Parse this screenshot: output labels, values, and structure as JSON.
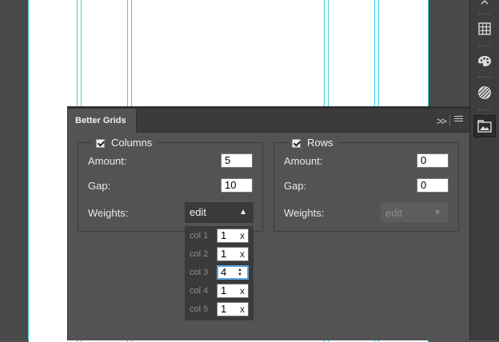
{
  "panel": {
    "tab_title": "Better Grids",
    "collapse_glyph": ">>",
    "columns": {
      "title": "Columns",
      "checked": true,
      "amount_label": "Amount:",
      "amount_value": "5",
      "gap_label": "Gap:",
      "gap_value": "10",
      "weights_label": "Weights:",
      "weights_dropdown": "edit",
      "weights_dropdown_arrow": "▲",
      "weights": [
        {
          "label": "col 1",
          "value": "1",
          "action": "x"
        },
        {
          "label": "col 2",
          "value": "1",
          "action": "x"
        },
        {
          "label": "col 3",
          "value": "4",
          "action": "spinner"
        },
        {
          "label": "col 4",
          "value": "1",
          "action": "x"
        },
        {
          "label": "col 5",
          "value": "1",
          "action": "x"
        }
      ]
    },
    "rows": {
      "title": "Rows",
      "checked": true,
      "amount_label": "Amount:",
      "amount_value": "0",
      "gap_label": "Gap:",
      "gap_value": "0",
      "weights_label": "Weights:",
      "weights_dropdown": "edit",
      "weights_dropdown_arrow": "▼"
    }
  },
  "toolbar": {
    "icons": [
      "collapse-icon",
      "grid-icon",
      "palette-icon",
      "sphere-icon",
      "image-folder-icon"
    ]
  },
  "colors": {
    "guide": "#39d3df",
    "panel_bg": "#535353",
    "focus_ring": "#5aa6e6"
  }
}
